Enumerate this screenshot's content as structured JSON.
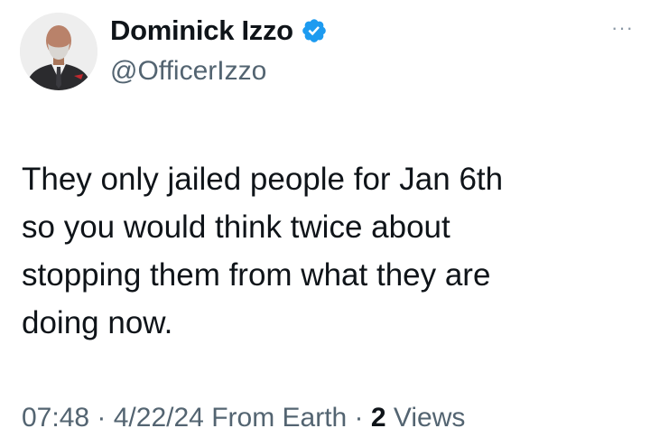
{
  "author": {
    "display_name": "Dominick Izzo",
    "handle": "@OfficerIzzo",
    "verified_color": "#1d9bf0"
  },
  "tweet": {
    "text": "They only jailed people for Jan 6th\nso you would think twice about\nstopping them from what they are\ndoing now."
  },
  "meta": {
    "time": "07:48",
    "separator": " · ",
    "date": "4/22/24",
    "source": "From Earth",
    "views_count": "2",
    "views_label": "Views"
  },
  "more_menu_label": "···"
}
